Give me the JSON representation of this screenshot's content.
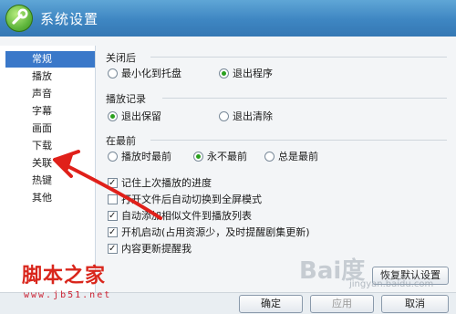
{
  "window": {
    "title": "系统设置"
  },
  "sidebar": {
    "items": [
      {
        "label": "常规",
        "active": true
      },
      {
        "label": "播放",
        "active": false
      },
      {
        "label": "声音",
        "active": false
      },
      {
        "label": "字幕",
        "active": false
      },
      {
        "label": "画面",
        "active": false
      },
      {
        "label": "下载",
        "active": false
      },
      {
        "label": "关联",
        "active": false
      },
      {
        "label": "热键",
        "active": false
      },
      {
        "label": "其他",
        "active": false
      }
    ]
  },
  "groups": {
    "close": {
      "label": "关闭后",
      "options": [
        {
          "label": "最小化到托盘",
          "selected": false
        },
        {
          "label": "退出程序",
          "selected": true
        }
      ]
    },
    "history": {
      "label": "播放记录",
      "options": [
        {
          "label": "退出保留",
          "selected": true
        },
        {
          "label": "退出清除",
          "selected": false
        }
      ]
    },
    "ontop": {
      "label": "在最前",
      "options": [
        {
          "label": "播放时最前",
          "selected": false
        },
        {
          "label": "永不最前",
          "selected": true
        },
        {
          "label": "总是最前",
          "selected": false
        }
      ]
    }
  },
  "checkboxes": [
    {
      "label": "记住上次播放的进度",
      "checked": true
    },
    {
      "label": "打开文件后自动切换到全屏模式",
      "checked": false
    },
    {
      "label": "自动添加相似文件到播放列表",
      "checked": true
    },
    {
      "label": "开机启动(占用资源少，及时提醒剧集更新)",
      "checked": true
    },
    {
      "label": "内容更新提醒我",
      "checked": true
    }
  ],
  "buttons": {
    "restore_defaults": "恢复默认设置",
    "ok": "确定",
    "apply": "应用",
    "cancel": "取消"
  },
  "watermarks": {
    "site_name": "脚本之家",
    "site_url": "www.jb51.net",
    "baidu": "Bai度",
    "baidu_url": "jingyan.baidu.com"
  },
  "colors": {
    "titlebar": "#3e86c2",
    "active_nav": "#3a78c9",
    "radio_dot": "#2aa01e",
    "arrow": "#e0201a"
  }
}
